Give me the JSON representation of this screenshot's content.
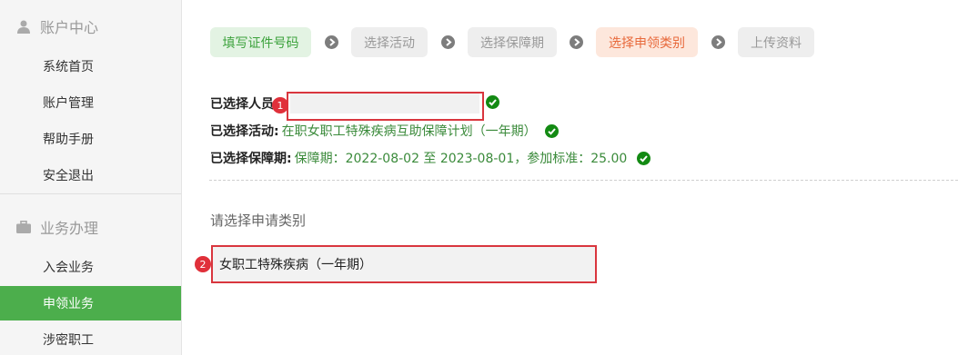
{
  "sidebar": {
    "account_header": "账户中心",
    "account_items": [
      "系统首页",
      "账户管理",
      "帮助手册",
      "安全退出"
    ],
    "business_header": "业务办理",
    "business_items": [
      "入会业务",
      "申领业务",
      "涉密职工"
    ],
    "active_item": "申领业务"
  },
  "steps": [
    {
      "label": "填写证件号码",
      "state": "done"
    },
    {
      "label": "选择活动",
      "state": "pending"
    },
    {
      "label": "选择保障期",
      "state": "pending"
    },
    {
      "label": "选择申领类别",
      "state": "current"
    },
    {
      "label": "上传资料",
      "state": "pending"
    }
  ],
  "info": {
    "person_label": "已选择人员",
    "person_value": "",
    "activity_label": "已选择活动:",
    "activity_value": "在职女职工特殊疾病互助保障计划（一年期）",
    "period_label": "已选择保障期:",
    "period_value": "保障期：2022-08-02 至 2023-08-01，参加标准：25.00"
  },
  "annotations": {
    "badge1": "1",
    "badge2": "2"
  },
  "category": {
    "title": "请选择申请类别",
    "options": [
      "女职工特殊疾病（一年期）"
    ]
  },
  "colors": {
    "accent_green": "#4cae4c",
    "current_step": "#e8693b",
    "highlight_red": "#d9363e"
  }
}
